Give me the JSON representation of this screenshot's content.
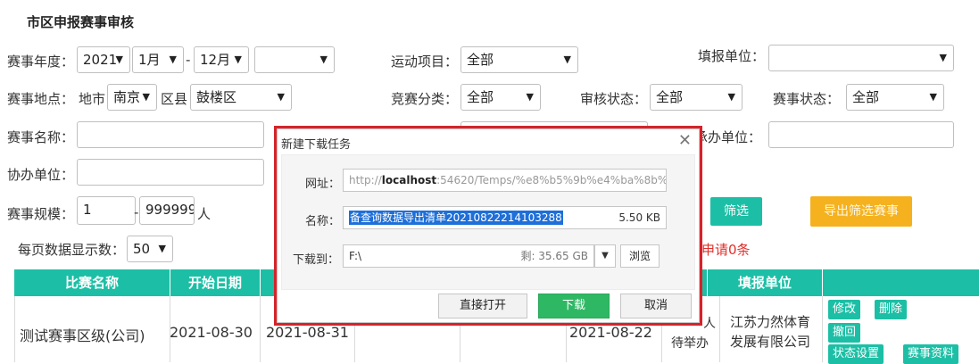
{
  "page": {
    "title": "市区申报赛事审核"
  },
  "filters": {
    "year_label": "赛事年度：",
    "year_value": "2021",
    "month_start": "1月",
    "dash": "-",
    "month_end": "12月",
    "extra_select": "",
    "sport_label": "运动项目：",
    "sport_value": "全部",
    "filler_label": "填报单位：",
    "filler_value": "",
    "location_label": "赛事地点：",
    "city_label": "地市",
    "city_value": "南京",
    "district_label": "区县",
    "district_value": "鼓楼区",
    "category_label": "竞赛分类：",
    "category_value": "全部",
    "review_label": "审核状态：",
    "review_value": "全部",
    "status_label": "赛事状态：",
    "status_value": "全部",
    "name_label": "赛事名称：",
    "organizer_label_partial": "承办单位：",
    "coorg_label": "协办单位：",
    "scale_label": "赛事规模：",
    "scale_min": "1",
    "scale_max": "999999",
    "scale_unit": "人",
    "filter_button": "筛选",
    "export_button": "导出筛选赛事",
    "page_size_label": "每页数据显示数：",
    "page_size_value": "50",
    "apply_count_partial": "申请0条"
  },
  "table": {
    "headers": [
      "比赛名称",
      "开始日期",
      "填报单位"
    ],
    "row": {
      "name": "测试赛事区级(公司)",
      "start_date": "2021-08-30",
      "end_date": "2021-08-31",
      "apply_date": "2021-08-22",
      "status_a": "人",
      "status_b": "待举办",
      "unit_line1": "江苏力然体育",
      "unit_line2": "发展有限公司",
      "actions": [
        "修改",
        "删除",
        "撤回",
        "状态设置",
        "赛事资料"
      ]
    }
  },
  "dialog": {
    "title": "新建下载任务",
    "url_label": "网址：",
    "url_prefix": "http://",
    "url_host": "localhost",
    "url_rest": ":54620/Temps/%e8%b5%9b%e4%ba%8b%",
    "name_label": "名称：",
    "file_name": "备查询数据导出清单20210822214103288",
    "file_size": "5.50 KB",
    "download_to_label": "下载到：",
    "path": "F:\\",
    "free_space": "剩: 35.65 GB",
    "browse_button": "浏览",
    "open_button": "直接打开",
    "download_button": "下载",
    "cancel_button": "取消"
  }
}
